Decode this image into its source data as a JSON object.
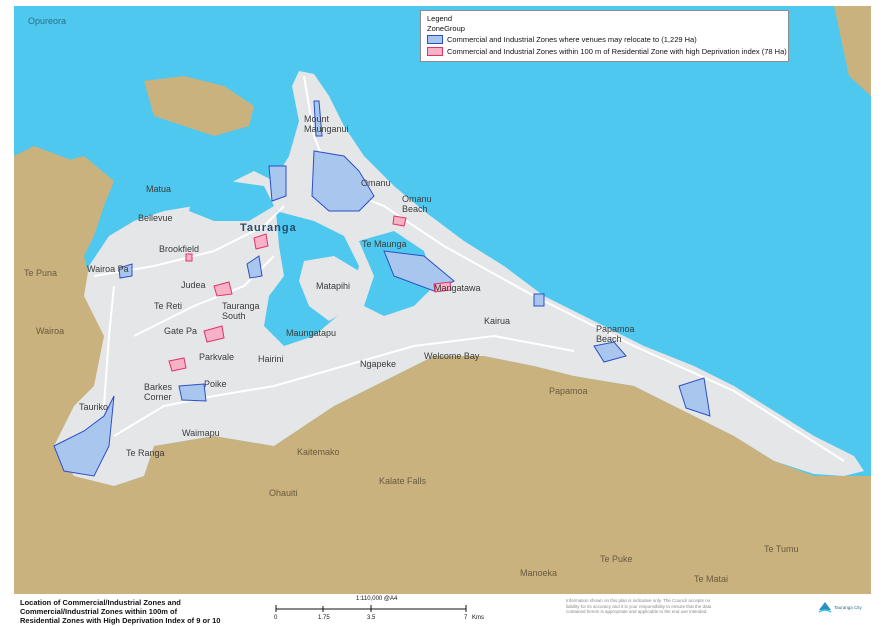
{
  "legend": {
    "title": "Legend",
    "group": "ZoneGroup",
    "items": [
      {
        "label": "Commercial and Industrial Zones where venues may relocate to (1,229 Ha)",
        "fill": "#a9c6ee",
        "stroke": "#2b4fc9"
      },
      {
        "label": "Commercial and Industrial Zones within 100 m of Residential Zone with high Deprivation index (78 Ha)",
        "fill": "#f7b2c8",
        "stroke": "#e0336a"
      }
    ]
  },
  "colors": {
    "water": "#4ec8ee",
    "land": "#c9b27e",
    "urban": "#e4e6e8",
    "road": "#ffffff"
  },
  "places": [
    {
      "name": "Opureora",
      "type": "water"
    },
    {
      "name": "Mount Maunganui",
      "type": "place"
    },
    {
      "name": "Omanu",
      "type": "place"
    },
    {
      "name": "Omanu Beach",
      "type": "place"
    },
    {
      "name": "Matua",
      "type": "place"
    },
    {
      "name": "Bellevue",
      "type": "place"
    },
    {
      "name": "Tauranga",
      "type": "city"
    },
    {
      "name": "Brookfield",
      "type": "place"
    },
    {
      "name": "Te Maunga",
      "type": "place"
    },
    {
      "name": "Te Puna",
      "type": "land"
    },
    {
      "name": "Wairoa Pa",
      "type": "place"
    },
    {
      "name": "Matapihi",
      "type": "place"
    },
    {
      "name": "Judea",
      "type": "place"
    },
    {
      "name": "Mangatawa",
      "type": "place"
    },
    {
      "name": "Te Reti",
      "type": "place"
    },
    {
      "name": "Tauranga South",
      "type": "place"
    },
    {
      "name": "Kairua",
      "type": "place"
    },
    {
      "name": "Papamoa Beach",
      "type": "place"
    },
    {
      "name": "Wairoa",
      "type": "land"
    },
    {
      "name": "Gate Pa",
      "type": "place"
    },
    {
      "name": "Maungatapu",
      "type": "place"
    },
    {
      "name": "Parkvale",
      "type": "place"
    },
    {
      "name": "Hairini",
      "type": "place"
    },
    {
      "name": "Ngapeke",
      "type": "place"
    },
    {
      "name": "Welcome Bay",
      "type": "place"
    },
    {
      "name": "Poike",
      "type": "place"
    },
    {
      "name": "Barkes Corner",
      "type": "place"
    },
    {
      "name": "Papamoa",
      "type": "land"
    },
    {
      "name": "Tauriko",
      "type": "place"
    },
    {
      "name": "Waimapu",
      "type": "place"
    },
    {
      "name": "Te Ranga",
      "type": "place"
    },
    {
      "name": "Kaitemako",
      "type": "land"
    },
    {
      "name": "Kalate Falls",
      "type": "land"
    },
    {
      "name": "Ohauiti",
      "type": "land"
    },
    {
      "name": "Te Puke",
      "type": "land"
    },
    {
      "name": "Te Tumu",
      "type": "land"
    },
    {
      "name": "Manoeka",
      "type": "land"
    },
    {
      "name": "Te Matai",
      "type": "land"
    }
  ],
  "footer": {
    "title_line1": "Location of Commercial/Industrial Zones and",
    "title_line2": "Commercial/Industrial Zones within 100m of",
    "title_line3": "Residential Zones with High Deprivation Index of 9 or 10",
    "scale_text": "1:110,000 @A4",
    "ticks": [
      "0",
      "1.75",
      "3.5",
      "7"
    ],
    "unit": "Kms",
    "disclaimer": "Information shown on this plan is indicative only. The Council accepts no liability for its accuracy and it is your responsibility to ensure that the data contained herein is appropriate and applicable to the end use intended.",
    "logo_text": "Tauranga City"
  }
}
